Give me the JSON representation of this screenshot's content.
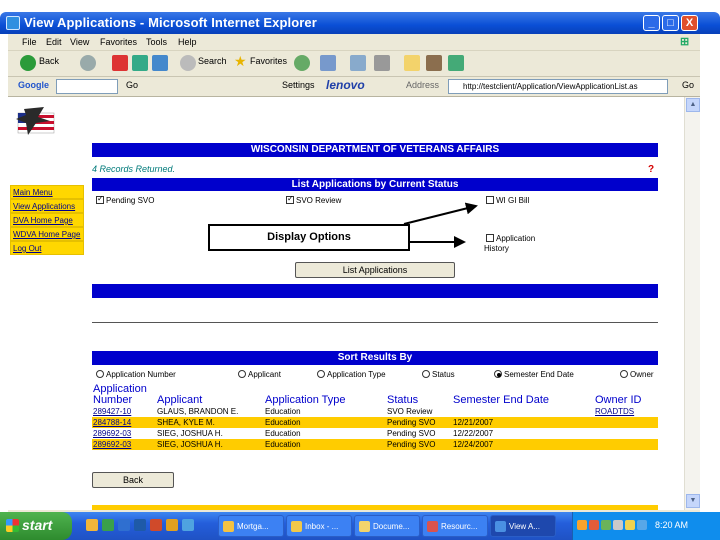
{
  "window": {
    "title": "View Applications - Microsoft Internet Explorer",
    "min": "_",
    "max": "□",
    "close": "X"
  },
  "menu": [
    "File",
    "Edit",
    "View",
    "Favorites",
    "Tools",
    "Help"
  ],
  "toolbar": {
    "back": "Back",
    "search": "Search",
    "favorites": "Favorites",
    "google": "Google",
    "go": "Go",
    "settings": "Settings",
    "lenovo": "lenovo",
    "address_label": "Address",
    "address_go": "Go",
    "address": "http://testclient/Application/ViewApplicationList.as"
  },
  "page": {
    "banner": "WISCONSIN DEPARTMENT OF VETERANS AFFAIRS",
    "records": "4 Records Returned.",
    "help": "?",
    "sidebar": [
      "Main Menu",
      "View Applications",
      "DVA Home Page",
      "WDVA Home Page",
      "Log Out"
    ],
    "filter_header": "List Applications by Current Status",
    "filters": {
      "pending_svo": "Pending SVO",
      "svo_review": "SVO Review",
      "wi_gi_bill": "WI GI Bill",
      "application_history_1": "Application",
      "application_history_2": "History"
    },
    "callout": "Display Options",
    "list_button": "List Applications",
    "sort_header": "Sort Results By",
    "sort_options": [
      "Application Number",
      "Applicant",
      "Application Type",
      "Status",
      "Semester End Date",
      "Owner"
    ],
    "columns": {
      "app_number_1": "Application",
      "app_number_2": "Number",
      "applicant": "Applicant",
      "type": "Application Type",
      "status": "Status",
      "semester": "Semester End Date",
      "owner": "Owner ID"
    },
    "rows": [
      {
        "number": "289427-10",
        "applicant": "GLAUS, BRANDON E.",
        "type": "Education",
        "status": "SVO Review",
        "semester": "",
        "owner": "ROADTDS"
      },
      {
        "number": "284788-14",
        "applicant": "SHEA, KYLE M.",
        "type": "Education",
        "status": "Pending SVO",
        "semester": "12/21/2007",
        "owner": ""
      },
      {
        "number": "289692-03",
        "applicant": "SIEG, JOSHUA H.",
        "type": "Education",
        "status": "Pending SVO",
        "semester": "12/22/2007",
        "owner": ""
      },
      {
        "number": "289692-03",
        "applicant": "SIEG, JOSHUA H.",
        "type": "Education",
        "status": "Pending SVO",
        "semester": "12/24/2007",
        "owner": ""
      }
    ],
    "back_button": "Back"
  },
  "taskbar": {
    "start": "start",
    "tasks": [
      "Mortga...",
      "Inbox - ...",
      "Docume...",
      "Resourc...",
      "View A..."
    ],
    "clock": "8:20 AM"
  },
  "colors": {
    "navy": "#0000cc",
    "highlight": "#ffcc00",
    "sidebar": "#ffd700"
  }
}
